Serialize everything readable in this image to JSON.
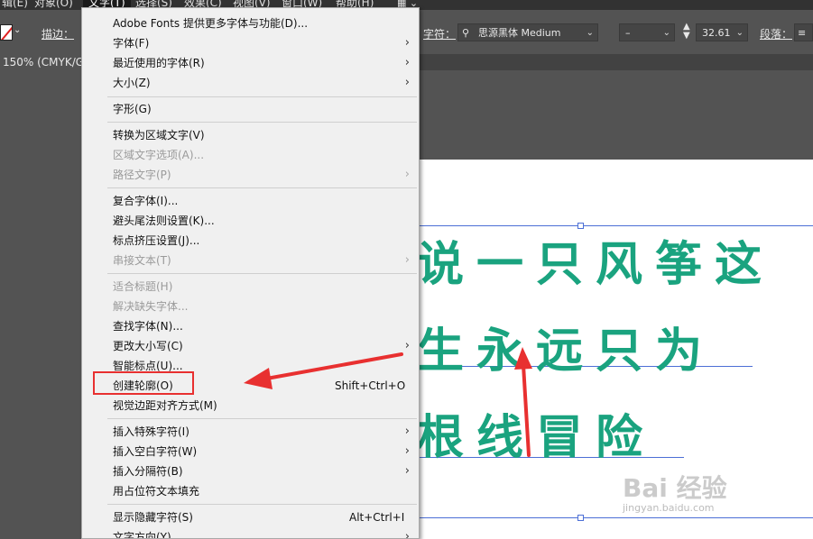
{
  "menubar": {
    "items": [
      {
        "label": "辑(E)"
      },
      {
        "label": "对象(O)"
      },
      {
        "label": "文字(T)"
      },
      {
        "label": "选择(S)"
      },
      {
        "label": "效果(C)"
      },
      {
        "label": "视图(V)"
      },
      {
        "label": "窗口(W)"
      },
      {
        "label": "帮助(H)"
      }
    ]
  },
  "control_bar": {
    "stroke_label": "描边：",
    "char_label": "字符：",
    "font_name": "思源黑体 Medium",
    "font_style": "–",
    "font_size": "32.61",
    "para_label": "段落："
  },
  "document_tab": {
    "label": "150% (CMYK/G"
  },
  "canvas": {
    "lines": [
      "说一只风筝这",
      "生永远只为",
      "根线冒险"
    ],
    "text_color": "#1aa37f"
  },
  "text_menu": {
    "items": [
      {
        "label": "Adobe Fonts 提供更多字体与功能(D)...",
        "shortcut": "",
        "submenu": false,
        "disabled": false
      },
      {
        "label": "字体(F)",
        "shortcut": "",
        "submenu": true,
        "disabled": false
      },
      {
        "label": "最近使用的字体(R)",
        "shortcut": "",
        "submenu": true,
        "disabled": false
      },
      {
        "label": "大小(Z)",
        "shortcut": "",
        "submenu": true,
        "disabled": false
      },
      {
        "label": "字形(G)",
        "shortcut": "",
        "submenu": false,
        "disabled": false
      },
      {
        "label": "转换为区域文字(V)",
        "shortcut": "",
        "submenu": false,
        "disabled": false
      },
      {
        "label": "区域文字选项(A)...",
        "shortcut": "",
        "submenu": false,
        "disabled": true
      },
      {
        "label": "路径文字(P)",
        "shortcut": "",
        "submenu": true,
        "disabled": true
      },
      {
        "label": "复合字体(I)...",
        "shortcut": "",
        "submenu": false,
        "disabled": false
      },
      {
        "label": "避头尾法则设置(K)...",
        "shortcut": "",
        "submenu": false,
        "disabled": false
      },
      {
        "label": "标点挤压设置(J)...",
        "shortcut": "",
        "submenu": false,
        "disabled": false
      },
      {
        "label": "串接文本(T)",
        "shortcut": "",
        "submenu": true,
        "disabled": true
      },
      {
        "label": "适合标题(H)",
        "shortcut": "",
        "submenu": false,
        "disabled": true
      },
      {
        "label": "解决缺失字体...",
        "shortcut": "",
        "submenu": false,
        "disabled": true
      },
      {
        "label": "查找字体(N)...",
        "shortcut": "",
        "submenu": false,
        "disabled": false
      },
      {
        "label": "更改大小写(C)",
        "shortcut": "",
        "submenu": true,
        "disabled": false
      },
      {
        "label": "智能标点(U)...",
        "shortcut": "",
        "submenu": false,
        "disabled": false
      },
      {
        "label": "创建轮廓(O)",
        "shortcut": "Shift+Ctrl+O",
        "submenu": false,
        "disabled": false
      },
      {
        "label": "视觉边距对齐方式(M)",
        "shortcut": "",
        "submenu": false,
        "disabled": false
      },
      {
        "label": "插入特殊字符(I)",
        "shortcut": "",
        "submenu": true,
        "disabled": false
      },
      {
        "label": "插入空白字符(W)",
        "shortcut": "",
        "submenu": true,
        "disabled": false
      },
      {
        "label": "插入分隔符(B)",
        "shortcut": "",
        "submenu": true,
        "disabled": false
      },
      {
        "label": "用占位符文本填充",
        "shortcut": "",
        "submenu": false,
        "disabled": false
      },
      {
        "label": "显示隐藏字符(S)",
        "shortcut": "Alt+Ctrl+I",
        "submenu": false,
        "disabled": false
      },
      {
        "label": "文字方向(Y)",
        "shortcut": "",
        "submenu": true,
        "disabled": false
      }
    ]
  },
  "watermark": {
    "brand": "Bai 经验",
    "url": "jingyan.baidu.com"
  },
  "colors": {
    "annotation_red": "#e83030",
    "guide_blue": "#4c6fd6"
  }
}
